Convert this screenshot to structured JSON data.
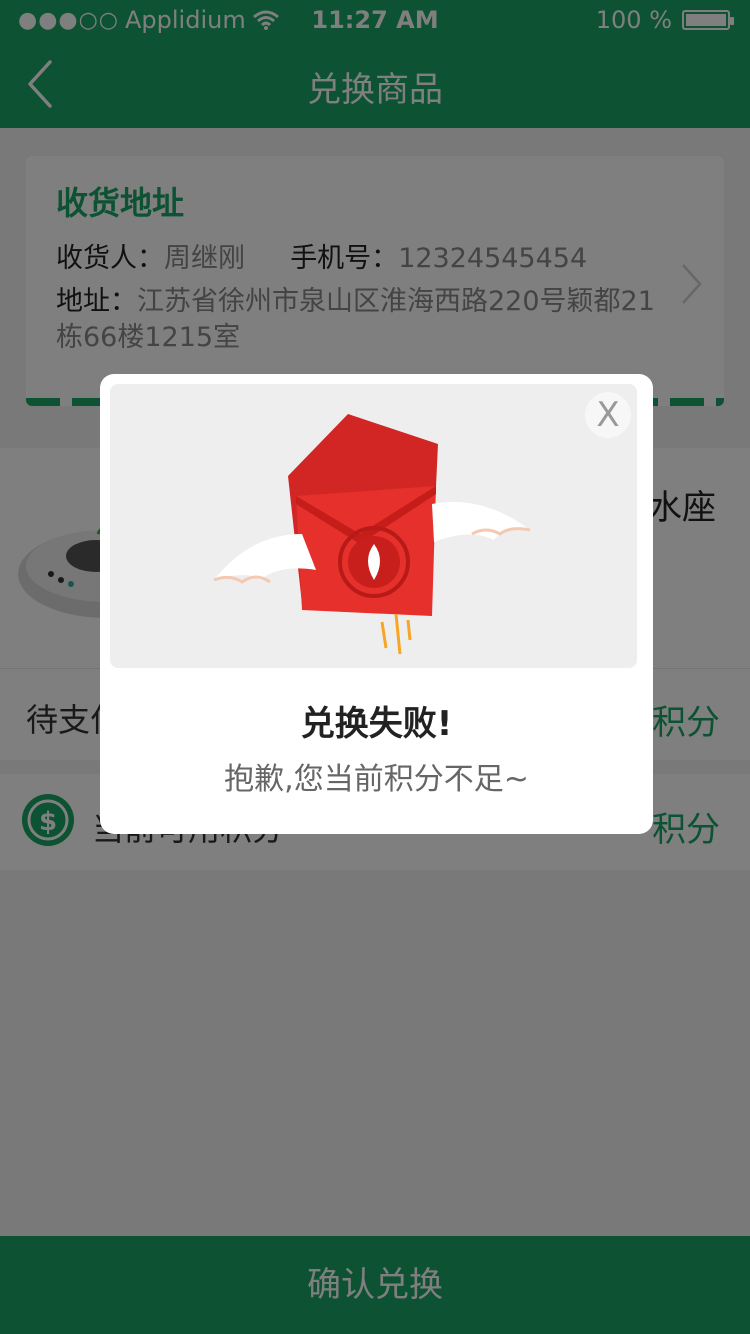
{
  "status_bar": {
    "carrier": "Applidium",
    "signal_dots": "●●●○○",
    "time": "11:27 AM",
    "battery": "100 %"
  },
  "nav": {
    "title": "兑换商品"
  },
  "address": {
    "heading": "收货地址",
    "receiver_label": "收货人：",
    "receiver_name": "周继刚",
    "phone_label": "手机号：",
    "phone": "12324545454",
    "address_label": "地址：",
    "address_text": "江苏省徐州市泉山区淮海西路220号颖都21栋66楼1215室"
  },
  "product": {
    "name_tail": "水座"
  },
  "payment": {
    "label": "待支付",
    "unit": "积分"
  },
  "balance": {
    "label": "当前可用积分",
    "unit": "积分"
  },
  "confirm": {
    "label": "确认兑换"
  },
  "modal": {
    "close_label": "X",
    "title": "兑换失败!",
    "message": "抱歉,您当前积分不足~"
  },
  "colors": {
    "brand_green": "#19a466",
    "envelope_red": "#e5302c",
    "coin_gold": "#f6b52a"
  }
}
